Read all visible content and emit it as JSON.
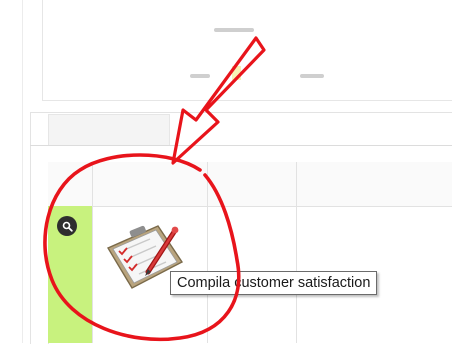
{
  "colors": {
    "annotation_red": "#e8141b",
    "row_highlight": "#c8f27e",
    "search_button": "#2e2e2e"
  },
  "grid": {
    "row": {
      "search_icon": "search-icon",
      "action_icon": "clipboard-checklist-icon"
    }
  },
  "tooltip": {
    "text": "Compila customer satisfaction"
  }
}
